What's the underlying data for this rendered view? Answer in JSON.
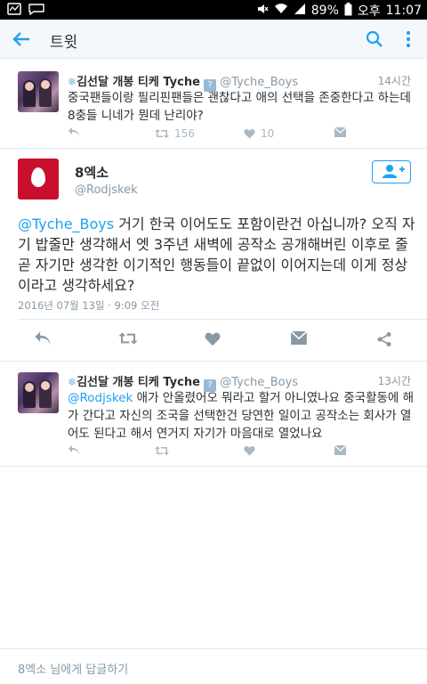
{
  "status_bar": {
    "battery": "89%",
    "ampm": "오후",
    "time": "11:07"
  },
  "app_bar": {
    "title": "트윗"
  },
  "reply1": {
    "display_name": "김선달 개봉 티케 Tyche",
    "badge": "?",
    "handle": "@Tyche_Boys",
    "time": "14시간",
    "text": "중국팬들이랑 필리핀팬들은 괜찮다고 애의 선택을 존중한다고 하는데 8충들 니네가 뭔데 난리야?",
    "retweets": "156",
    "likes": "10"
  },
  "main_tweet": {
    "display_name": "8엑소",
    "handle": "@Rodjskek",
    "mention": "@Tyche_Boys",
    "text": " 거기 한국 이어도도 포함이란건 아십니까? 오직 자기 밥줄만 생각해서 엣 3주년 새벽에 공작소 공개해버린 이후로 줄곧 자기만 생각한 이기적인 행동들이 끝없이 이어지는데 이게 정상이라고 생각하세요?",
    "timestamp": "2016년 07월 13일 · 9:09 오전"
  },
  "reply2": {
    "display_name": "김선달 개봉 티케 Tyche",
    "badge": "?",
    "handle": "@Tyche_Boys",
    "time": "13시간",
    "mention": "@Rodjskek",
    "text": " 애가 안올렸어오 뭐라고 할거 아니였나요 중국활동에 해가 간다고 자신의 조국을 선택한건 당연한 일이고 공작소는 회사가 열어도 된다고 해서 연거지 자기가 마음대로 열었나요"
  },
  "reply_box": {
    "placeholder": "8엑소 님에게 답글하기"
  },
  "colors": {
    "accent": "#1da1f2",
    "muted": "#8899a6",
    "avatar_red": "#c8102e"
  }
}
